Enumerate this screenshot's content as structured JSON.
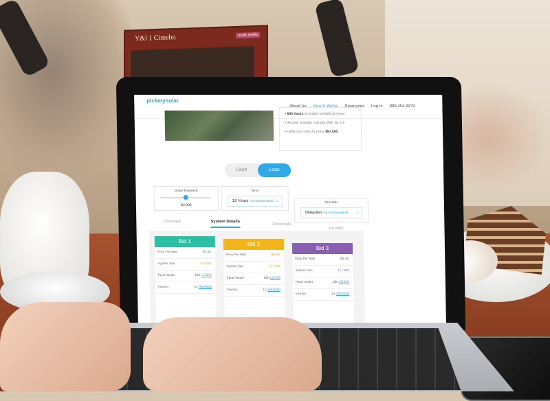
{
  "scene": {
    "placard_text": "Y&l 1 Cimebn",
    "placard_tag": "suds mello"
  },
  "site": {
    "logo": "pickmysolar",
    "nav": [
      "About Us",
      "How It Works",
      "Resources",
      "Log In",
      "888.454.9979"
    ],
    "stats": [
      {
        "bold": "600 hours",
        "rest": " of usable sunlight per year"
      },
      {
        "bold": "",
        "rest": "25 year average cost per kWh: $1.2 ¢"
      },
      {
        "bold": "$87,500",
        "rest": "utility cost over 25 years "
      }
    ],
    "toggle": {
      "cash": "Cash",
      "loan": "Loan"
    },
    "down_payment": {
      "label": "Down Payment",
      "value": "$2,000",
      "level_fraction": 0.5
    },
    "term": {
      "label": "Term",
      "value": "12 Years",
      "rec": "(recommended)"
    },
    "provider": {
      "label": "Provider",
      "value": "Matadors",
      "rec": "(recommended)"
    },
    "tabs": [
      "Overview",
      "System Details",
      "Financials",
      "Installer"
    ],
    "bids": [
      {
        "title": "Bid 1",
        "color": "#2bbfa4",
        "price_label": "Price Per Watt",
        "price": "$3.45",
        "size_label": "System Size",
        "size": "6.7 kW",
        "panel_label": "Panel Model",
        "panel_qty": "18x",
        "panel": "LG300",
        "inverter_label": "Inverter",
        "inverter_qty": "1x",
        "inverter": "SMA550"
      },
      {
        "title": "Bid 2",
        "color": "#f2b51d",
        "price_label": "Price Per Watt",
        "price": "$3.45",
        "size_label": "System Size",
        "size": "6.7 kW",
        "panel_label": "Panel Model",
        "panel_qty": "18x",
        "panel": "LG300",
        "inverter_label": "Inverter",
        "inverter_qty": "1x",
        "inverter": "SMA550"
      },
      {
        "title": "Bid 3",
        "color": "#8a5fb1",
        "price_label": "Price Per Watt",
        "price": "$3.45",
        "size_label": "System Size",
        "size": "6.7 kW",
        "panel_label": "Panel Model",
        "panel_qty": "18x",
        "panel": "LG300",
        "inverter_label": "Inverter",
        "inverter_qty": "1x",
        "inverter": "SMA550"
      }
    ]
  }
}
